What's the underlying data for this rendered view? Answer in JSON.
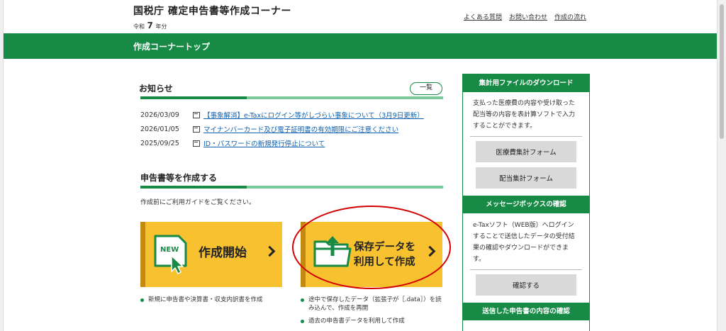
{
  "header": {
    "title": "国税庁 確定申告書等作成コーナー",
    "era_prefix": "令和",
    "era_year": "7",
    "era_suffix": "年分",
    "links": [
      "よくある質問",
      "お問い合わせ",
      "作成の流れ"
    ]
  },
  "nav": {
    "title": "作成コーナートップ"
  },
  "news": {
    "heading": "お知らせ",
    "list_button": "一覧",
    "items": [
      {
        "date": "2026/03/09",
        "text": "【事象解消】e-Taxにログイン等がしづらい事象について（3月9日更新）"
      },
      {
        "date": "2026/01/05",
        "text": "マイナンバーカード及び電子証明書の有効期限にご注意ください"
      },
      {
        "date": "2025/09/25",
        "text": "ID・パスワードの新規発行停止について"
      }
    ]
  },
  "create": {
    "heading": "申告書等を作成する",
    "guide": "作成前にご利用ガイドをご覧ください。",
    "start_card": {
      "badge": "NEW",
      "label": "作成開始",
      "desc": [
        "新規に申告書や決算書・収支内訳書を作成"
      ]
    },
    "saved_card": {
      "label_line1": "保存データを",
      "label_line2": "利用して作成",
      "desc": [
        "途中で保存したデータ（拡張子が［.data］）を読み込んで、作成を再開",
        "過去の申告書データを利用して作成"
      ]
    }
  },
  "sidebar": {
    "download": {
      "heading": "集計用ファイルのダウンロード",
      "text": "支払った医療費の内容や受け取った配当等の内容を表計算ソフトで入力することができます。",
      "buttons": [
        "医療費集計フォーム",
        "配当集計フォーム"
      ]
    },
    "message_box": {
      "heading": "メッセージボックスの確認",
      "text": "e-Taxソフト（WEB版）へログインすることで送信したデータの受付結果の確認やダウンロードができます。",
      "button": "確認する"
    },
    "next_heading": "送信した申告書の内容の確認"
  },
  "colors": {
    "brand_green": "#178a46",
    "card_yellow": "#f7c12f",
    "highlight_red": "#d40000"
  }
}
